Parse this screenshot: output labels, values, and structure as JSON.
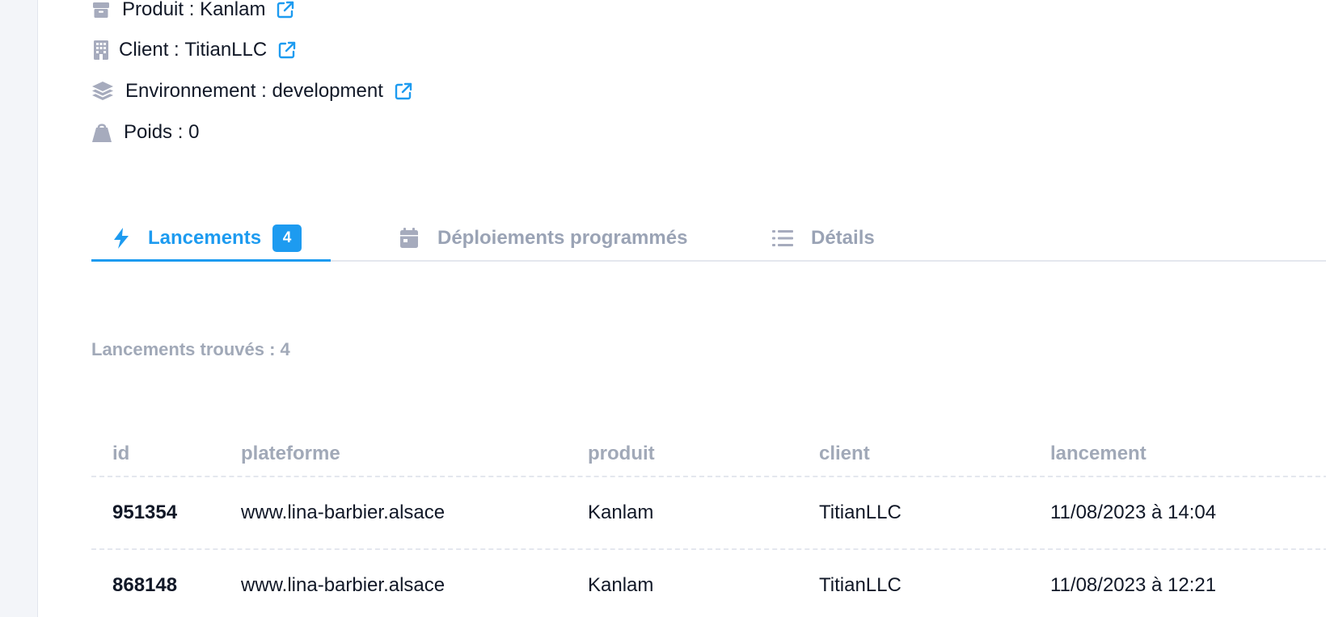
{
  "info": {
    "produit": {
      "label": "Produit",
      "value": "Kanlam"
    },
    "client": {
      "label": "Client",
      "value": "TitianLLC"
    },
    "environnement": {
      "label": "Environnement",
      "value": "development"
    },
    "poids": {
      "label": "Poids",
      "value": "0"
    }
  },
  "tabs": [
    {
      "label": "Lancements",
      "badge": "4",
      "active": true,
      "icon": "bolt-icon"
    },
    {
      "label": "Déploiements programmés",
      "active": false,
      "icon": "calendar-icon"
    },
    {
      "label": "Détails",
      "active": false,
      "icon": "list-icon"
    }
  ],
  "found_count": "Lancements trouvés : 4",
  "table": {
    "headers": [
      "id",
      "plateforme",
      "produit",
      "client",
      "lancement"
    ],
    "rows": [
      [
        "951354",
        "www.lina-barbier.alsace",
        "Kanlam",
        "TitianLLC",
        "11/08/2023 à 14:04"
      ],
      [
        "868148",
        "www.lina-barbier.alsace",
        "Kanlam",
        "TitianLLC",
        "11/08/2023 à 12:21"
      ]
    ]
  },
  "colors": {
    "accent": "#1d9bf0",
    "muted": "#a1a9b8",
    "icon_gray": "#a6abbd"
  }
}
